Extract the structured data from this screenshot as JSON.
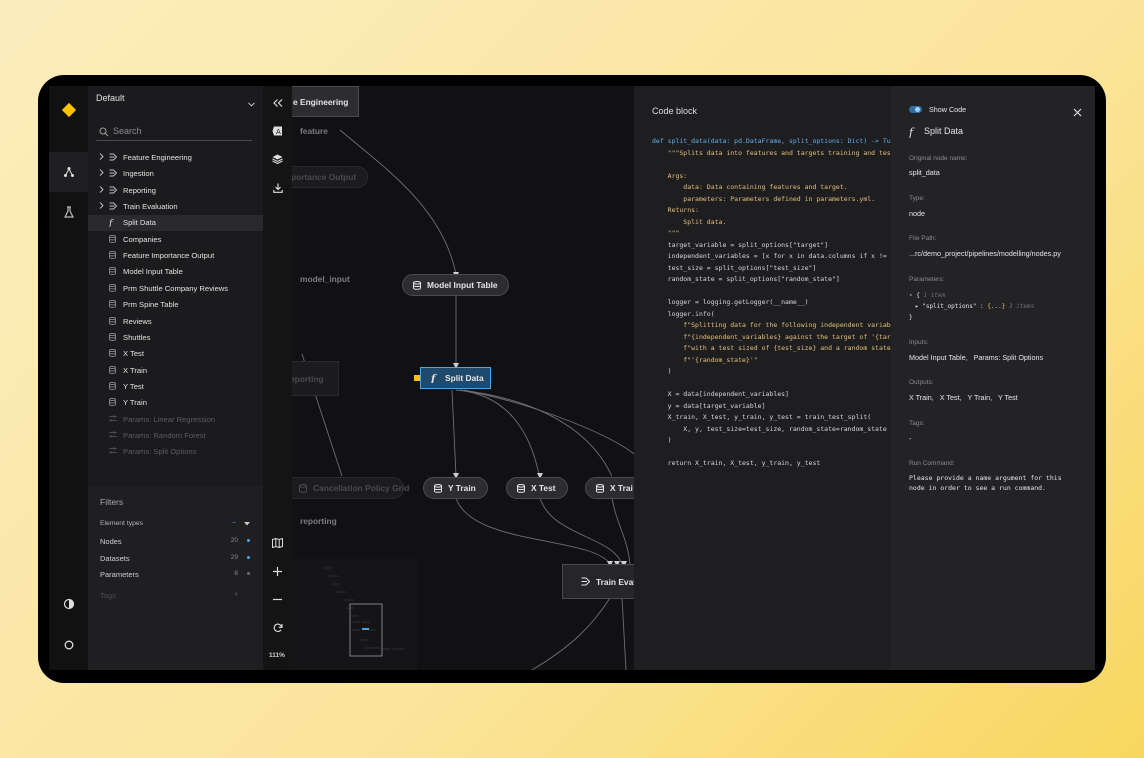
{
  "sidebar": {
    "pipeline_select": "Default",
    "search_placeholder": "Search",
    "tree": [
      {
        "label": "Feature Engineering",
        "kind": "modular-pipeline"
      },
      {
        "label": "Ingestion",
        "kind": "modular-pipeline"
      },
      {
        "label": "Reporting",
        "kind": "modular-pipeline"
      },
      {
        "label": "Train Evaluation",
        "kind": "modular-pipeline"
      },
      {
        "label": "Split Data",
        "kind": "task",
        "selected": true
      },
      {
        "label": "Companies",
        "kind": "dataset"
      },
      {
        "label": "Feature Importance Output",
        "kind": "dataset"
      },
      {
        "label": "Model Input Table",
        "kind": "dataset"
      },
      {
        "label": "Prm Shuttle Company Reviews",
        "kind": "dataset"
      },
      {
        "label": "Prm Spine Table",
        "kind": "dataset"
      },
      {
        "label": "Reviews",
        "kind": "dataset"
      },
      {
        "label": "Shuttles",
        "kind": "dataset"
      },
      {
        "label": "X Test",
        "kind": "dataset"
      },
      {
        "label": "X Train",
        "kind": "dataset"
      },
      {
        "label": "Y Test",
        "kind": "dataset"
      },
      {
        "label": "Y Train",
        "kind": "dataset"
      },
      {
        "label": "Params: Linear Regression",
        "kind": "parameters",
        "disabled": true
      },
      {
        "label": "Params: Random Forest",
        "kind": "parameters",
        "disabled": true
      },
      {
        "label": "Params: Split Options",
        "kind": "parameters",
        "disabled": true
      }
    ],
    "filters": {
      "title": "Filters",
      "element_types_label": "Element types",
      "rows": [
        {
          "label": "Nodes",
          "count": "20",
          "color": "#4fa3e0"
        },
        {
          "label": "Datasets",
          "count": "29",
          "color": "#4fa3e0"
        },
        {
          "label": "Parameters",
          "count": "6",
          "color": "#6c6c70"
        }
      ],
      "tags_label": "Tags",
      "tags_count": "4"
    }
  },
  "canvas": {
    "layer_labels": {
      "feature": "feature",
      "model_input": "model_input",
      "reporting": "reporting"
    },
    "nodes": {
      "feature_engineering": "e Engineering",
      "importance_output": "portance Output",
      "model_input_table": "Model Input Table",
      "reporting": "eporting",
      "split_data": "Split Data",
      "cancellation": "Cancellation Policy Grid",
      "y_train": "Y Train",
      "x_test": "X Test",
      "x_train": "X Trai",
      "train_eval": "Train Evalu"
    },
    "zoom": "111%"
  },
  "code": {
    "title": "Code block",
    "lines": [
      "def split_data(data: pd.DataFrame, split_options: Dict) -> Tu",
      "    \"\"\"Splits data into features and targets training and tes",
      "",
      "    Args:",
      "        data: Data containing features and target.",
      "        parameters: Parameters defined in parameters.yml.",
      "    Returns:",
      "        Split data.",
      "    \"\"\"",
      "    target_variable = split_options[\"target\"]",
      "    independent_variables = [x for x in data.columns if x != '",
      "    test_size = split_options[\"test_size\"]",
      "    random_state = split_options[\"random_state\"]",
      "",
      "    logger = logging.getLogger(__name__)",
      "    logger.info(",
      "        f\"Splitting data for the following independent variab",
      "        f\"{independent_variables} against the target of '{targ",
      "        f\"with a test sized of {test_size} and a random state",
      "        f\"'{random_state}'\"",
      "    )",
      "",
      "    X = data[independent_variables]",
      "    y = data[target_variable]",
      "    X_train, X_test, y_train, y_test = train_test_split(",
      "        X, y, test_size=test_size, random_state=random_state",
      "    )",
      "",
      "    return X_train, X_test, y_train, y_test"
    ]
  },
  "details": {
    "show_code_label": "Show Code",
    "title": "Split Data",
    "original_node_name_label": "Original node name:",
    "original_node_name": "split_data",
    "type_label": "Type:",
    "type": "node",
    "file_path_label": "File Path:",
    "file_path": "...rc/demo_project/pipelines/modelling/nodes.py",
    "parameters_label": "Parameters:",
    "params_items": "1 item",
    "params_key": "\"split_options\"",
    "params_value": "{...}",
    "params_value_items": "3 items",
    "inputs_label": "Inputs:",
    "inputs": "Model Input Table,   Params: Split Options",
    "outputs_label": "Outputs:",
    "outputs": "X Train,   X Test,   Y Train,   Y Test",
    "tags_label": "Tags:",
    "tags": "-",
    "run_command_label": "Run Command:",
    "run_command": "Please provide a name argument for this node in order to see a run command."
  }
}
